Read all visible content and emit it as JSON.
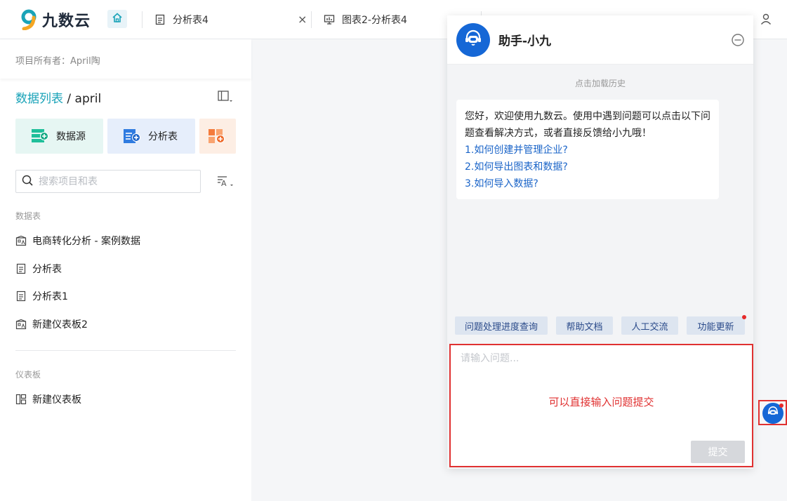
{
  "brand": {
    "name": "九数云",
    "accent_color": "#1aa3b8",
    "primary_color": "#1567d6"
  },
  "topbar": {
    "home_icon": "home-icon",
    "tabs": [
      {
        "label": "分析表4",
        "icon": "table-doc-icon"
      },
      {
        "label": "图表2-分析表4",
        "icon": "chart-screen-icon"
      }
    ],
    "close_glyph": "×",
    "user_icon": "user-icon"
  },
  "sidebar": {
    "owner": "项目所有者：April陶",
    "list_title_prefix": "数据列表",
    "list_title_suffix": " / april",
    "quick_actions": [
      {
        "label": "数据源",
        "icon": "datasource-add-icon"
      },
      {
        "label": "分析表",
        "icon": "analysis-add-icon"
      }
    ],
    "search_placeholder": "搜索项目和表",
    "sections": {
      "tables": {
        "label": "数据表",
        "items": [
          {
            "label": "电商转化分析 - 案例数据",
            "icon": "dashboard-building-icon"
          },
          {
            "label": "分析表",
            "icon": "table-doc-icon"
          },
          {
            "label": "分析表1",
            "icon": "table-doc-icon"
          },
          {
            "label": "新建仪表板2",
            "icon": "dashboard-building-icon"
          }
        ]
      },
      "dashboards": {
        "label": "仪表板",
        "items": [
          {
            "label": "新建仪表板",
            "icon": "dashboard-layout-icon"
          }
        ]
      }
    }
  },
  "chat": {
    "title": "助手-小九",
    "load_history": "点击加载历史",
    "welcome": "您好，欢迎使用九数云。使用中遇到问题可以点击以下问题查看解决方式，或者直接反馈给小九哦！",
    "faq": [
      "1.如何创建并管理企业?",
      "2.如何导出图表和数据?",
      "3.如何导入数据?"
    ],
    "chips": [
      "问题处理进度查询",
      "帮助文档",
      "人工交流",
      "功能更新"
    ],
    "input_placeholder": "请输入问题...",
    "hint": "可以直接输入问题提交",
    "submit_label": "提交",
    "highlight_color": "#e03131"
  }
}
